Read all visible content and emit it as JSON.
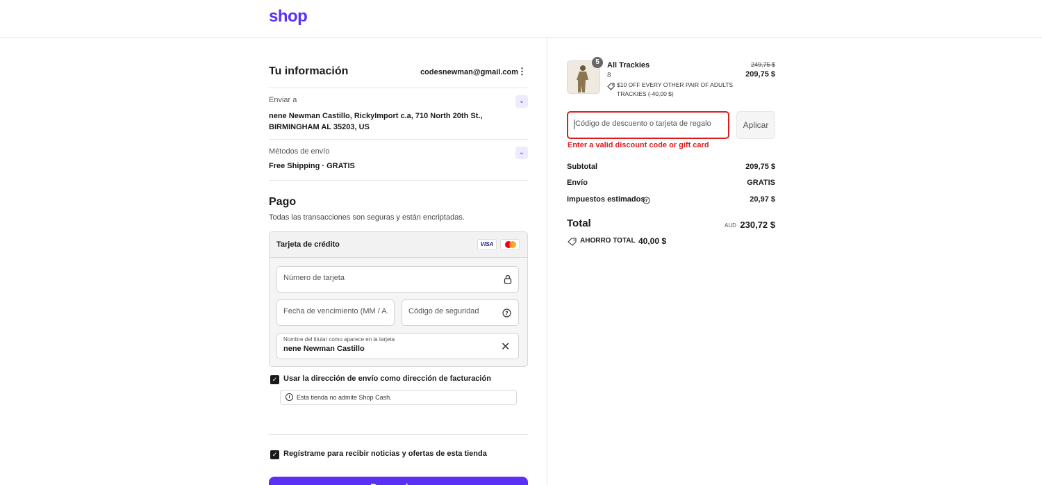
{
  "header": {
    "logo": "shop"
  },
  "info": {
    "title": "Tu información",
    "email": "codesnewman@gmail.com",
    "ship_to_label": "Enviar a",
    "ship_to_value": "nene Newman Castillo, RickyImport c.a, 710 North 20th St., BIRMINGHAM AL 35203, US",
    "shipping_method_label": "Métodos de envío",
    "shipping_method_value": "Free Shipping · GRATIS"
  },
  "payment": {
    "title": "Pago",
    "subtitle": "Todas las transacciones son seguras y están encriptadas.",
    "method_label": "Tarjeta de crédito",
    "card_brands": [
      "VISA",
      "Mastercard"
    ],
    "card_number_placeholder": "Número de tarjeta",
    "expiry_placeholder": "Fecha de vencimiento (MM / A.",
    "cvv_placeholder": "Código de seguridad",
    "holder_label": "Nombre del titular como aparece en la tarjeta",
    "holder_value": "nene Newman Castillo",
    "billing_same_label": "Usar la dirección de envío como dirección de facturación",
    "shop_cash_note": "Esta tienda no admite Shop Cash.",
    "newsletter_label": "Regístrame para recibir noticias y ofertas de esta tienda",
    "pay_button": "Pagar ahora"
  },
  "order": {
    "item_name": "All Trackies",
    "item_variant": "8",
    "item_qty": "5",
    "item_price_original": "249,75 $",
    "item_price": "209,75 $",
    "item_discount": "$10 OFF EVERY OTHER PAIR OF ADULTS TRACKIES (-40,00 $)",
    "discount_placeholder": "Código de descuento o tarjeta de regalo",
    "apply_button": "Aplicar",
    "discount_error": "Enter a valid discount code or gift card",
    "subtotal_label": "Subtotal",
    "subtotal_value": "209,75 $",
    "shipping_label": "Envío",
    "shipping_value": "GRATIS",
    "taxes_label": "Impuestos estimados",
    "taxes_value": "20,97 $",
    "total_label": "Total",
    "total_currency": "AUD",
    "total_value": "230,72 $",
    "savings_label": "AHORRO TOTAL",
    "savings_value": "40,00 $"
  },
  "colors": {
    "brand": "#5a31f4",
    "error": "#dd1d1d"
  }
}
